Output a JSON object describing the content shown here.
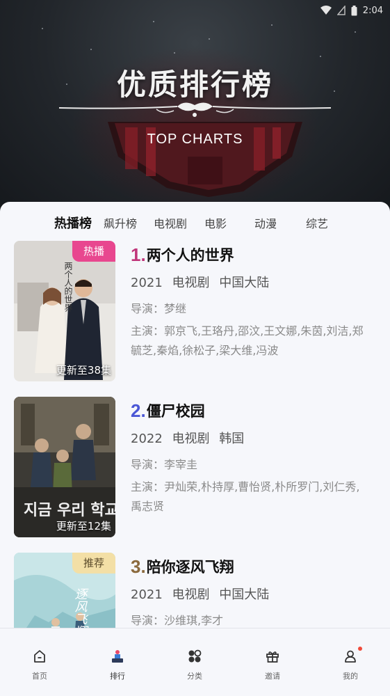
{
  "status_bar": {
    "time": "2:04",
    "icons": [
      "wifi-icon",
      "signal-icon",
      "battery-icon"
    ]
  },
  "hero": {
    "title": "优质排行榜",
    "subtitle": "TOP CHARTS"
  },
  "tabs": [
    {
      "label": "热播榜",
      "active": true
    },
    {
      "label": "飙升榜",
      "active": false
    },
    {
      "label": "电视剧",
      "active": false
    },
    {
      "label": "电影",
      "active": false
    },
    {
      "label": "动漫",
      "active": false
    },
    {
      "label": "综艺",
      "active": false
    }
  ],
  "items": [
    {
      "rank": "1.",
      "rank_color": "#c0357a",
      "title": "两个人的世界",
      "year": "2021",
      "type": "电视剧",
      "region": "中国大陆",
      "director": "导演：梦继",
      "cast": "主演：郭京飞,王珞丹,邵汶,王文娜,朱茵,刘洁,郑毓芝,秦焰,徐松子,梁大维,冯波",
      "tag": "热播",
      "tag_color": "#e8478f",
      "update": "更新至38集",
      "poster_text": "两个人的世界"
    },
    {
      "rank": "2.",
      "rank_color": "#4b57d6",
      "title": "僵尸校园",
      "year": "2022",
      "type": "电视剧",
      "region": "韩国",
      "director": "导演：李宰圭",
      "cast": "主演：尹灿荣,朴持厚,曹怡贤,朴所罗门,刘仁秀,禹志贤",
      "tag": "",
      "tag_color": "",
      "update": "更新至12集",
      "poster_text": "지금 우리 학교는"
    },
    {
      "rank": "3.",
      "rank_color": "#8b6a3e",
      "title": "陪你逐风飞翔",
      "year": "2021",
      "type": "电视剧",
      "region": "中国大陆",
      "director": "导演：沙维琪,李才",
      "cast": "",
      "tag": "推荐",
      "tag_color": "#f3dfa6",
      "update": "",
      "poster_text": "逐风飞翔"
    }
  ],
  "bottom_nav": [
    {
      "label": "首页",
      "icon": "home-icon",
      "active": false
    },
    {
      "label": "排行",
      "icon": "ranking-icon",
      "active": true
    },
    {
      "label": "分类",
      "icon": "category-icon",
      "active": false
    },
    {
      "label": "邀请",
      "icon": "gift-icon",
      "active": false
    },
    {
      "label": "我的",
      "icon": "profile-icon",
      "active": false,
      "badge": true
    }
  ]
}
